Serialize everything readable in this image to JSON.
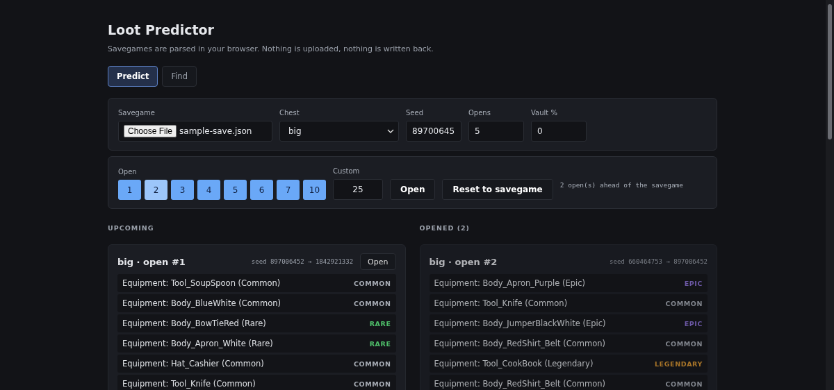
{
  "title": "Loot Predictor",
  "subtitle": "Savegames are parsed in your browser. Nothing is uploaded, nothing is written back.",
  "tabs": [
    {
      "label": "Predict",
      "selected": true
    },
    {
      "label": "Find",
      "selected": false
    }
  ],
  "settings": {
    "savegame": {
      "label": "Savegame",
      "button": "Choose File",
      "file": "sample-save.json"
    },
    "chest": {
      "label": "Chest",
      "value": "big"
    },
    "seed": {
      "label": "Seed",
      "value": "89700645"
    },
    "opens": {
      "label": "Opens",
      "value": "5"
    },
    "vault": {
      "label": "Vault %",
      "value": "0"
    }
  },
  "open_panel": {
    "label": "Open",
    "buttons": [
      "1",
      "2",
      "3",
      "4",
      "5",
      "6",
      "7",
      "10"
    ],
    "custom_label": "Custom",
    "custom_value": "25",
    "open_button": "Open",
    "reset_button": "Reset to savegame",
    "status": "2 open(s) ahead of the savegame"
  },
  "upcoming": {
    "heading": "UPCOMING",
    "card": {
      "title": "big · open #1",
      "seed": "seed 897006452 → 1842921332",
      "button": "Open",
      "items": [
        {
          "name": "Equipment: Tool_SoupSpoon (Common)",
          "rarity": "COMMON",
          "kind": "common"
        },
        {
          "name": "Equipment: Body_BlueWhite (Common)",
          "rarity": "COMMON",
          "kind": "common"
        },
        {
          "name": "Equipment: Body_BowTieRed (Rare)",
          "rarity": "RARE",
          "kind": "rare"
        },
        {
          "name": "Equipment: Body_Apron_White (Rare)",
          "rarity": "RARE",
          "kind": "rare"
        },
        {
          "name": "Equipment: Hat_Cashier (Common)",
          "rarity": "COMMON",
          "kind": "common"
        },
        {
          "name": "Equipment: Tool_Knife (Common)",
          "rarity": "COMMON",
          "kind": "common"
        }
      ]
    }
  },
  "opened": {
    "heading": "OPENED (2)",
    "card": {
      "title": "big · open #2",
      "seed": "seed 660464753 → 897006452",
      "items": [
        {
          "name": "Equipment: Body_Apron_Purple (Epic)",
          "rarity": "EPIC",
          "kind": "epic"
        },
        {
          "name": "Equipment: Tool_Knife (Common)",
          "rarity": "COMMON",
          "kind": "common"
        },
        {
          "name": "Equipment: Body_JumperBlackWhite (Epic)",
          "rarity": "EPIC",
          "kind": "epic"
        },
        {
          "name": "Equipment: Body_RedShirt_Belt (Common)",
          "rarity": "COMMON",
          "kind": "common"
        },
        {
          "name": "Equipment: Tool_CookBook (Legendary)",
          "rarity": "LEGENDARY",
          "kind": "legendary"
        },
        {
          "name": "Equipment: Body_RedShirt_Belt (Common)",
          "rarity": "COMMON",
          "kind": "common"
        }
      ]
    }
  }
}
